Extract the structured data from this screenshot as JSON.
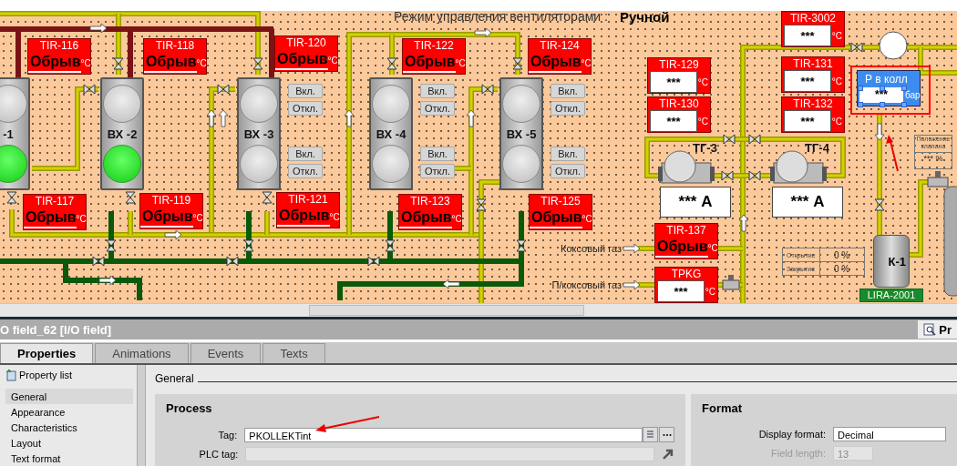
{
  "canvas": {
    "mode_label": "Режим управления вентиляторами :",
    "mode_value": "Ручной",
    "fans": [
      {
        "label": "-1",
        "top_on": false,
        "bottom_on": true
      },
      {
        "label": "ВХ -2",
        "top_on": false,
        "bottom_on": true
      },
      {
        "label": "ВХ -3",
        "top_on": false,
        "bottom_on": false,
        "buttons": [
          "Вкл.",
          "Откл.",
          "Вкл.",
          "Откл."
        ]
      },
      {
        "label": "ВХ -4",
        "top_on": false,
        "bottom_on": false,
        "buttons": [
          "Вкл.",
          "Откл.",
          "Вкл.",
          "Откл."
        ]
      },
      {
        "label": "ВХ -5",
        "top_on": false,
        "bottom_on": false,
        "buttons": [
          "Вкл.",
          "Откл.",
          "Вкл.",
          "Откл."
        ]
      }
    ],
    "tags": [
      {
        "label": "TIR-116",
        "kind": "break",
        "value": "Обрыв",
        "unit": "°C"
      },
      {
        "label": "TIR-118",
        "kind": "break",
        "value": "Обрыв",
        "unit": "°C"
      },
      {
        "label": "TIR-120",
        "kind": "break",
        "value": "Обрыв",
        "unit": "°C"
      },
      {
        "label": "TIR-122",
        "kind": "break",
        "value": "Обрыв",
        "unit": "°C"
      },
      {
        "label": "TIR-124",
        "kind": "break",
        "value": "Обрыв",
        "unit": "°C"
      },
      {
        "label": "TIR-117",
        "kind": "break",
        "value": "Обрыв",
        "unit": "°C"
      },
      {
        "label": "TIR-119",
        "kind": "break",
        "value": "Обрыв",
        "unit": "°C"
      },
      {
        "label": "TIR-121",
        "kind": "break",
        "value": "Обрыв",
        "unit": "°C"
      },
      {
        "label": "TIR-123",
        "kind": "break",
        "value": "Обрыв",
        "unit": "°C"
      },
      {
        "label": "TIR-125",
        "kind": "break",
        "value": "Обрыв",
        "unit": "°C"
      },
      {
        "label": "TIR-3002",
        "kind": "reading",
        "value": "***",
        "unit": "°C"
      },
      {
        "label": "TIR-129",
        "kind": "reading",
        "value": "***",
        "unit": "°C"
      },
      {
        "label": "TIR-130",
        "kind": "reading",
        "value": "***",
        "unit": "°C"
      },
      {
        "label": "TIR-131",
        "kind": "reading",
        "value": "***",
        "unit": "°C"
      },
      {
        "label": "TIR-132",
        "kind": "reading",
        "value": "***",
        "unit": "°C"
      },
      {
        "label": "TIR-137",
        "kind": "break",
        "value": "Обрыв",
        "unit": "°C"
      },
      {
        "label": "TPKG",
        "kind": "reading",
        "value": "***",
        "unit": "°C"
      }
    ],
    "generators": [
      {
        "label": "ТГ-3",
        "reading": "*** А"
      },
      {
        "label": "ТГ-4",
        "reading": "*** А"
      }
    ],
    "pressure": {
      "label": "Р в колл",
      "value": "***",
      "unit": "бар",
      "selected": true
    },
    "valve_position": {
      "label": "Положение клапана",
      "value": "*** %"
    },
    "valve_travel": [
      {
        "label": "Открытие",
        "value": "0 %"
      },
      {
        "label": "Закрытие",
        "value": "0 %"
      }
    ],
    "tank": {
      "label": "К-1"
    },
    "level_tag": {
      "label": "LIRA-2001"
    },
    "gas_inputs": [
      "Коксовый газ",
      "П/коксовый газ"
    ]
  },
  "inspector": {
    "title": "O field_62 [I/O field]",
    "corner_tab": "Pr",
    "tabs": [
      {
        "label": "Properties",
        "selected": true
      },
      {
        "label": "Animations",
        "selected": false
      },
      {
        "label": "Events",
        "selected": false
      },
      {
        "label": "Texts",
        "selected": false
      }
    ],
    "sidebar": {
      "title": "Property list",
      "items": [
        {
          "label": "General",
          "selected": true
        },
        {
          "label": "Appearance",
          "selected": false
        },
        {
          "label": "Characteristics",
          "selected": false
        },
        {
          "label": "Layout",
          "selected": false
        },
        {
          "label": "Text format",
          "selected": false
        }
      ]
    },
    "section": "General",
    "process": {
      "title": "Process",
      "tag_label": "Tag:",
      "tag_value": "PKOLLEKTint",
      "plc_tag_label": "PLC tag:"
    },
    "format": {
      "title": "Format",
      "display_format_label": "Display format:",
      "display_format": "Decimal",
      "field_length_label": "Field length:",
      "field_length": "13",
      "field_length_disabled": true
    }
  }
}
